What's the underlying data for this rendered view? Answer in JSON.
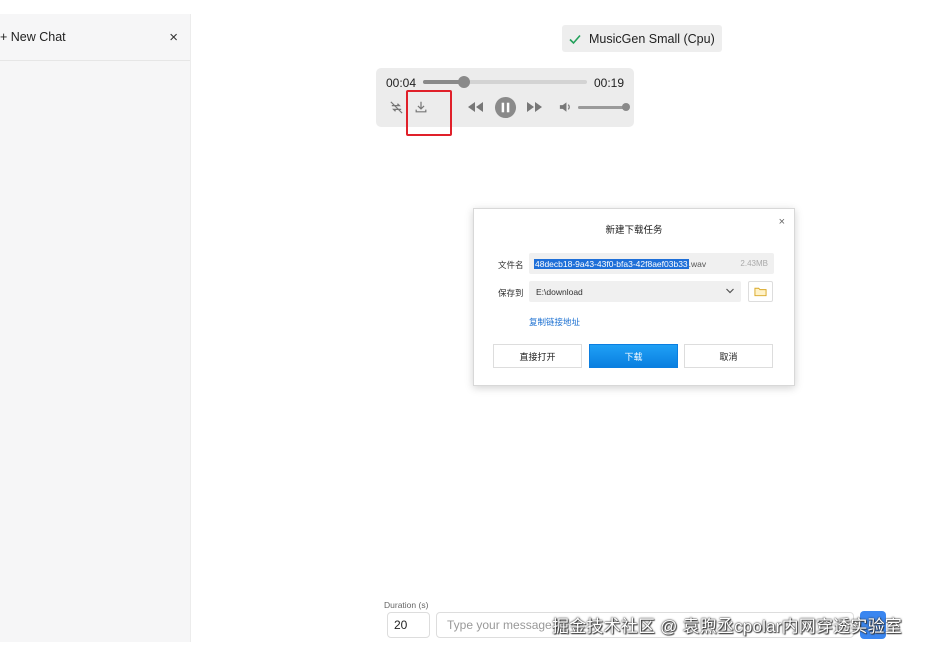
{
  "sidebar": {
    "new_chat_label": "+ New Chat",
    "close_label": "×"
  },
  "model_badge": {
    "label": "MusicGen Small (Cpu)",
    "icon": "check-icon",
    "icon_color": "#22a05a"
  },
  "player": {
    "current_time": "00:04",
    "duration": "00:19",
    "progress_fraction": 0.25,
    "volume_fraction": 1.0,
    "controls": [
      "repeat-off-icon",
      "download-icon",
      "rewind-icon",
      "pause-icon",
      "fast-forward-icon",
      "volume-icon"
    ]
  },
  "download_dialog": {
    "title": "新建下载任务",
    "close_label": "×",
    "filename_label": "文件名",
    "filename_selected": "48decb18-9a43-43f0-bfa3-42f8aef03b33",
    "filename_ext": ".wav",
    "file_size": "2.43MB",
    "save_to_label": "保存到",
    "save_path": "E:\\download",
    "copy_link_label": "复制链接地址",
    "open_button": "直接打开",
    "download_button": "下载",
    "cancel_button": "取消"
  },
  "input_bar": {
    "duration_label": "Duration (s)",
    "duration_value": "20",
    "message_placeholder": "Type your message..."
  },
  "watermark": "掘金技术社区 @ 袁煦丞cpolar内网穿透实验室",
  "colors": {
    "accent": "#1a8ff0",
    "highlight": "#e0202a"
  }
}
